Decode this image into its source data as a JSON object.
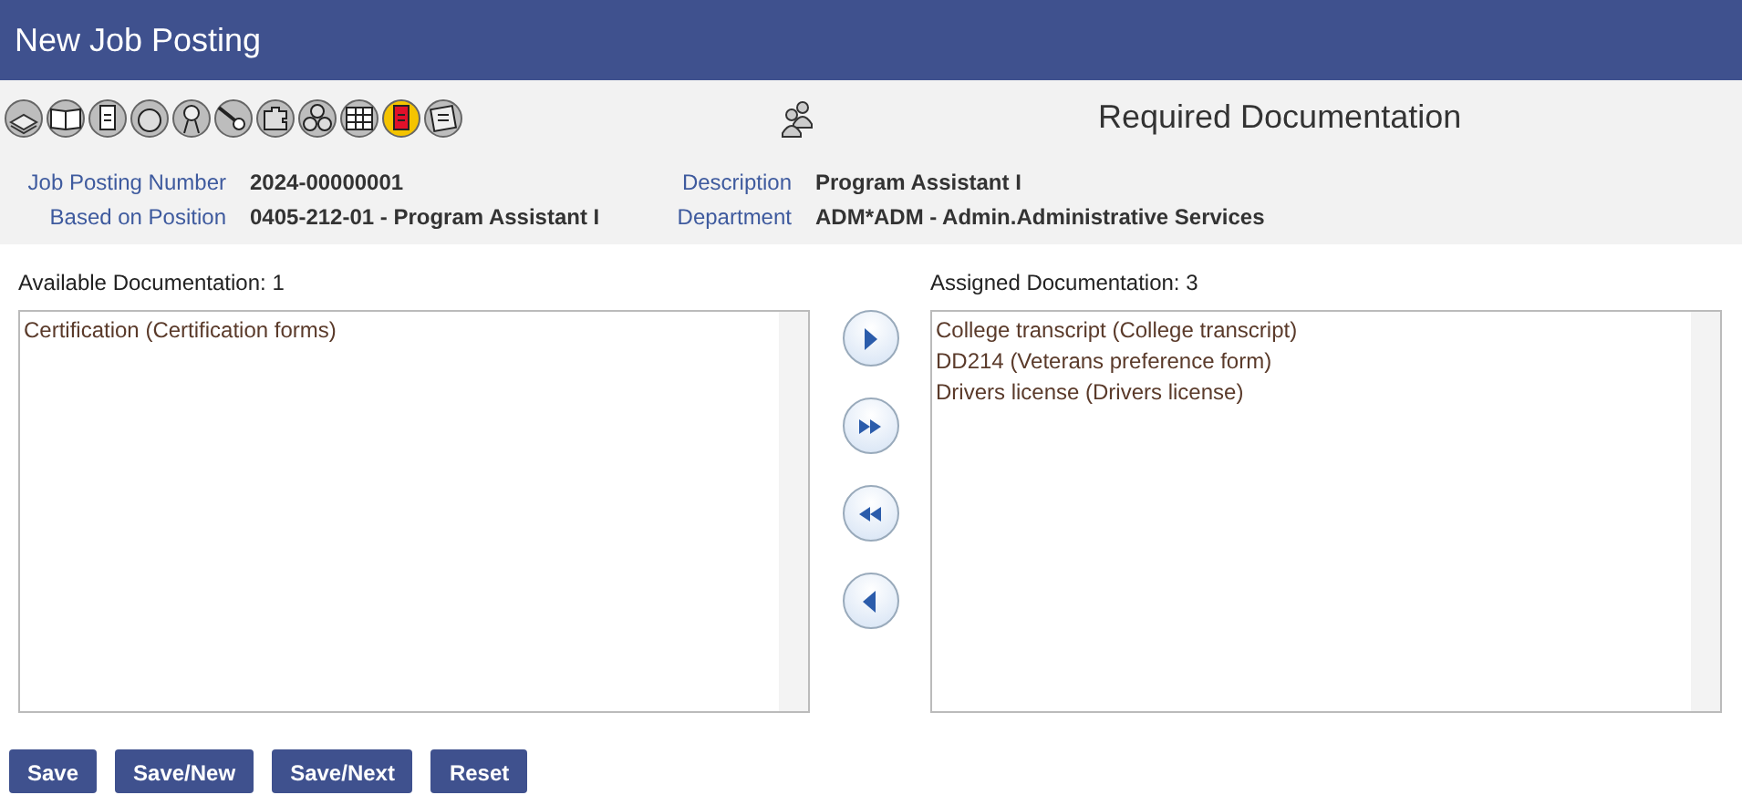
{
  "window": {
    "title": "New Job Posting"
  },
  "toolbar": {
    "icons": [
      {
        "kind": "stack",
        "highlighted": false
      },
      {
        "kind": "book",
        "highlighted": false
      },
      {
        "kind": "document",
        "highlighted": false
      },
      {
        "kind": "circle",
        "highlighted": false
      },
      {
        "kind": "ribbon",
        "highlighted": false
      },
      {
        "kind": "dish",
        "highlighted": false
      },
      {
        "kind": "puzzle",
        "highlighted": false
      },
      {
        "kind": "circles",
        "highlighted": false
      },
      {
        "kind": "table",
        "highlighted": false
      },
      {
        "kind": "document",
        "highlighted": true
      },
      {
        "kind": "note",
        "highlighted": false
      }
    ],
    "section_title": "Required Documentation"
  },
  "info": [
    {
      "label": "Job Posting Number",
      "value": "2024-00000001"
    },
    {
      "label": "Description",
      "value": "Program Assistant I"
    },
    {
      "label": "Based on Position",
      "value": "0405-212-01 - Program Assistant I"
    },
    {
      "label": "Department",
      "value": "ADM*ADM - Admin.Administrative Services"
    }
  ],
  "available": {
    "label": "Available Documentation: 1",
    "items": [
      "Certification (Certification forms)"
    ]
  },
  "assigned": {
    "label": "Assigned Documentation: 3",
    "items": [
      "College transcript (College transcript)",
      "DD214 (Veterans preference form)",
      "Drivers license (Drivers license)"
    ]
  },
  "move_buttons": [
    {
      "kind": "add"
    },
    {
      "kind": "add_all"
    },
    {
      "kind": "remove_all"
    },
    {
      "kind": "remove"
    }
  ],
  "buttons": [
    "Save",
    "Save/New",
    "Save/Next",
    "Reset"
  ]
}
